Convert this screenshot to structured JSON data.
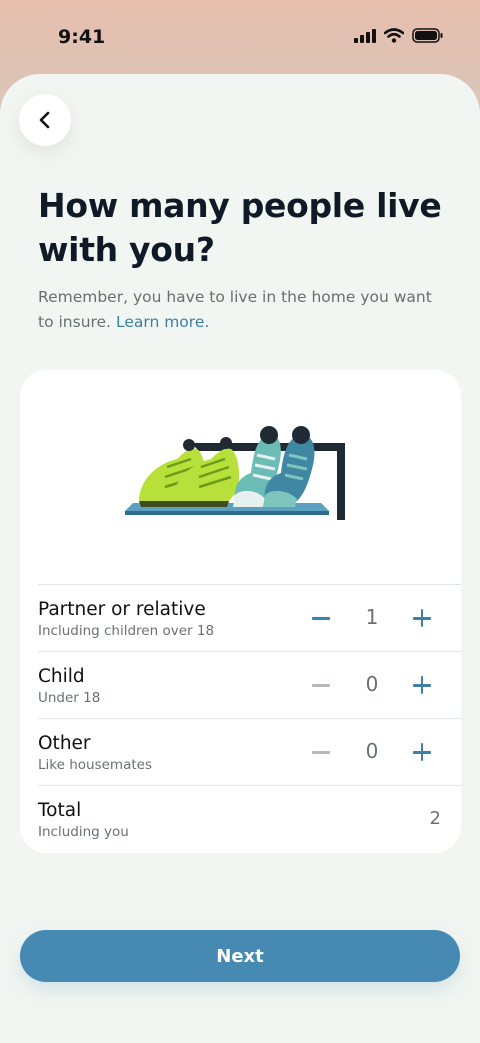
{
  "status_bar": {
    "time": "9:41"
  },
  "header": {
    "title": "How many people live with you?",
    "subtitle": "Remember, you have to live in the home you want to insure.",
    "learn_more": "Learn more."
  },
  "household": {
    "rows": [
      {
        "title": "Partner or relative",
        "subtitle": "Including children over 18",
        "value": "1"
      },
      {
        "title": "Child",
        "subtitle": "Under 18",
        "value": "0"
      },
      {
        "title": "Other",
        "subtitle": "Like housemates",
        "value": "0"
      }
    ],
    "total": {
      "title": "Total",
      "subtitle": "Including you",
      "value": "2"
    }
  },
  "footer": {
    "next_label": "Next"
  },
  "colors": {
    "accent": "#468ab4",
    "background": "#f2f6f2",
    "card": "#ffffff"
  }
}
